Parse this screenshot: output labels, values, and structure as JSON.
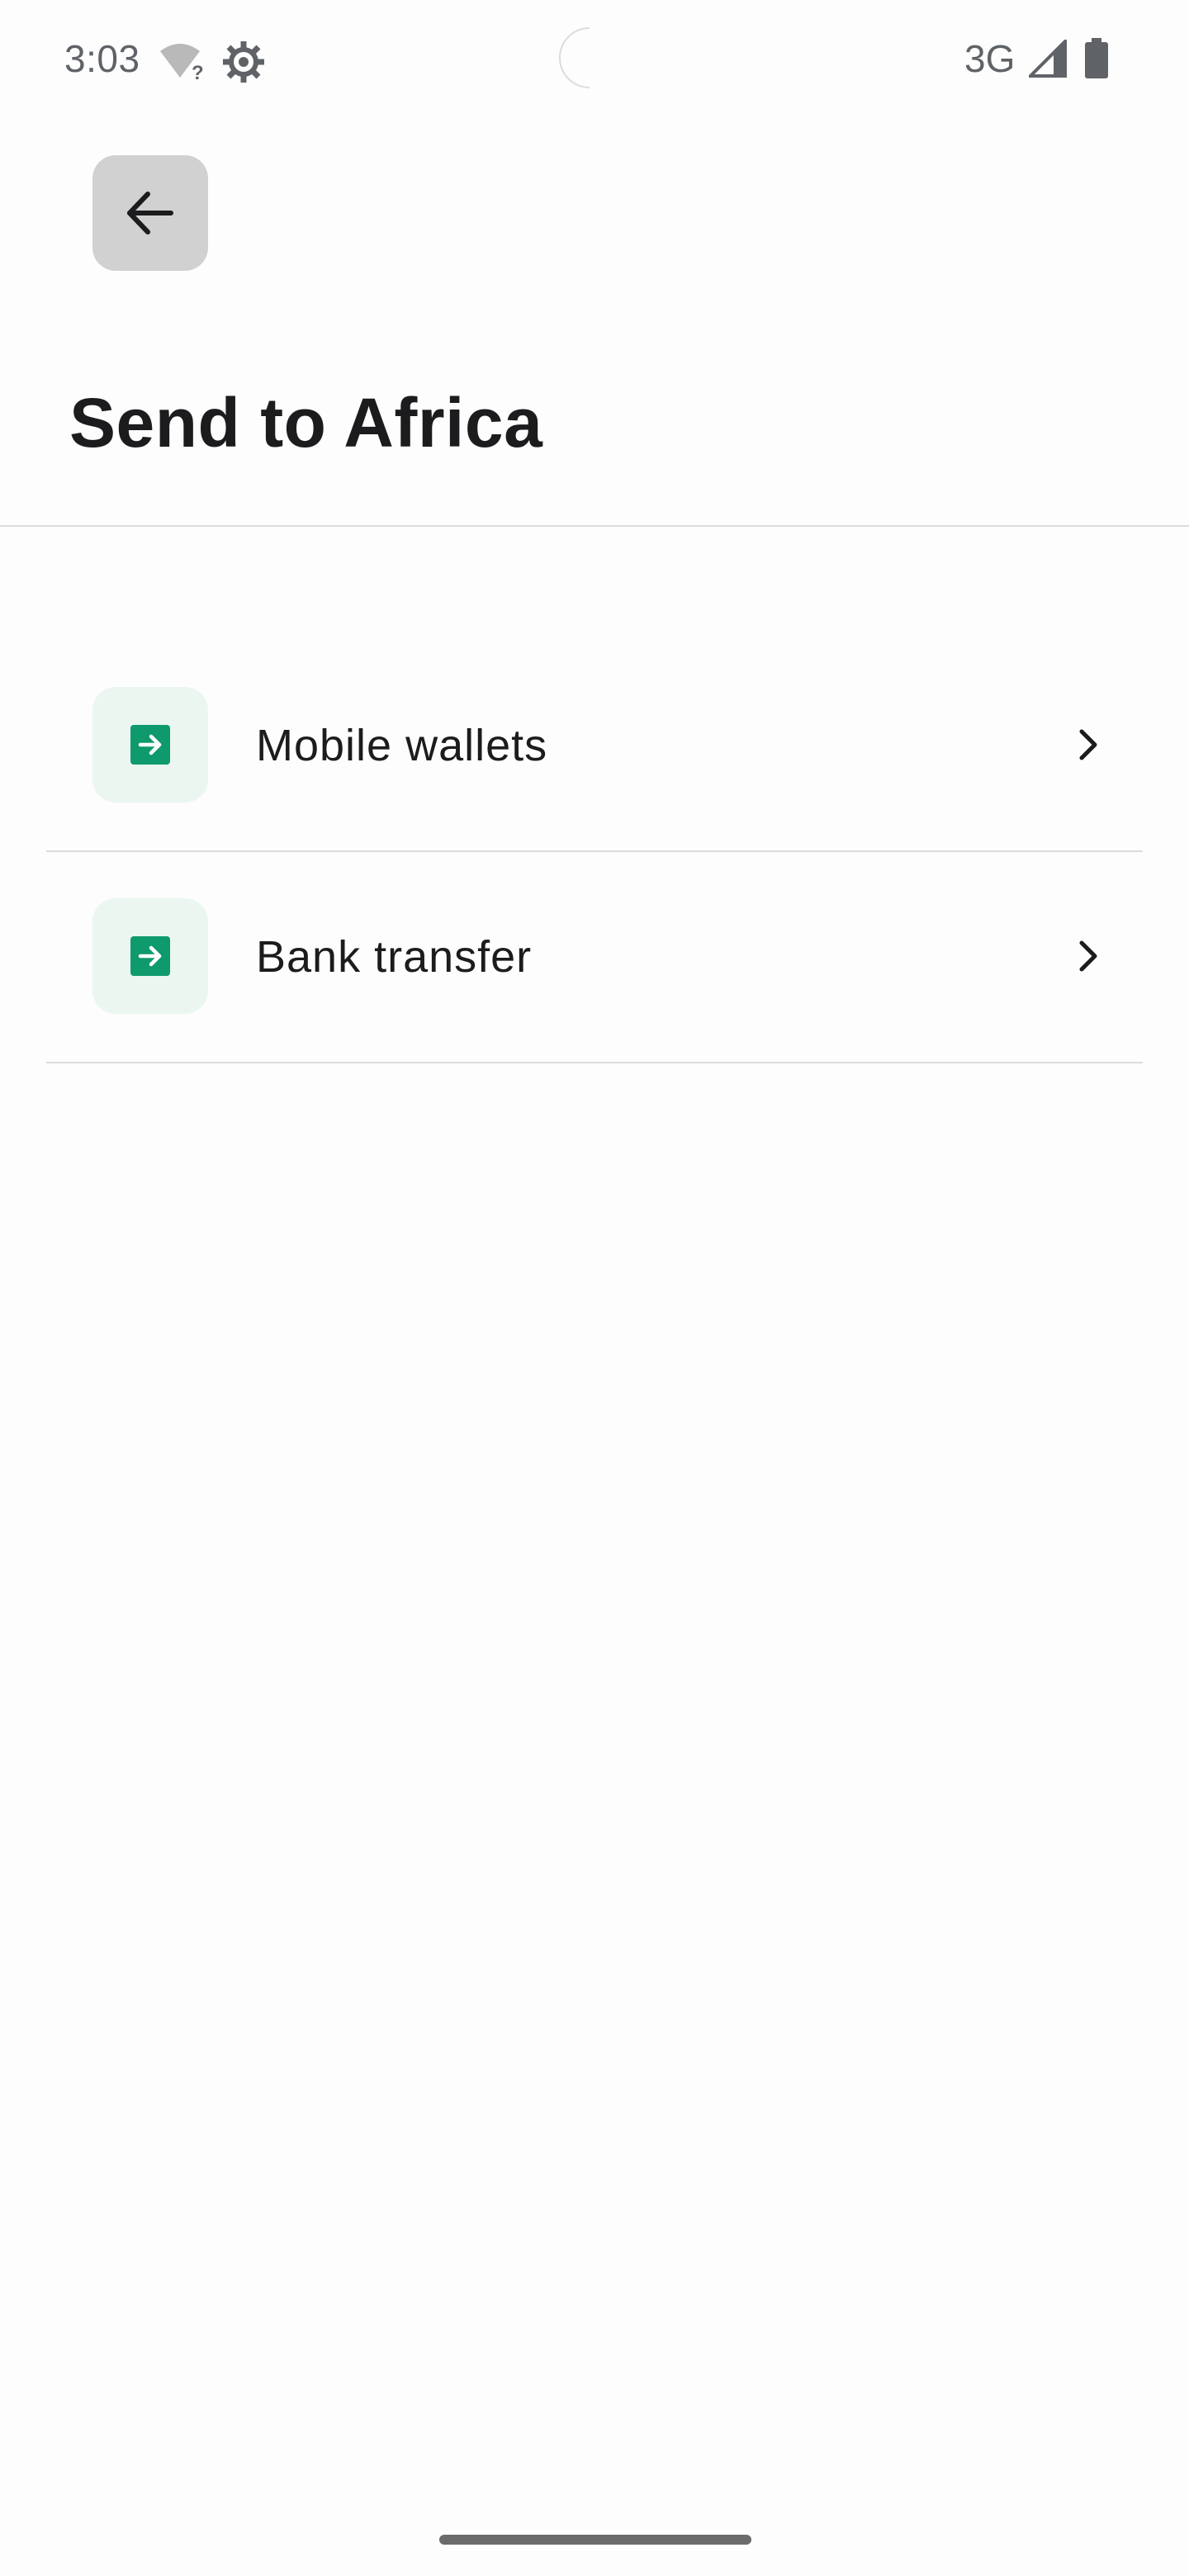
{
  "status_bar": {
    "time": "3:03",
    "network": "3G",
    "icons": [
      "wifi-question-icon",
      "gear-icon",
      "signal-icon",
      "battery-icon"
    ]
  },
  "header": {
    "back_icon": "arrow-left-icon",
    "title": "Send to Africa"
  },
  "options": [
    {
      "label": "Mobile wallets",
      "icon": "arrow-right-box-icon",
      "trailing_icon": "chevron-right-icon"
    },
    {
      "label": "Bank transfer",
      "icon": "arrow-right-box-icon",
      "trailing_icon": "chevron-right-icon"
    }
  ],
  "colors": {
    "accent": "#0e9a6c",
    "icon_tile_bg": "#ebf6f1",
    "back_button_bg": "#d1d1d1",
    "divider": "#dcdcdc",
    "text_primary": "#1c1c1e",
    "status_text": "#5f6368"
  }
}
